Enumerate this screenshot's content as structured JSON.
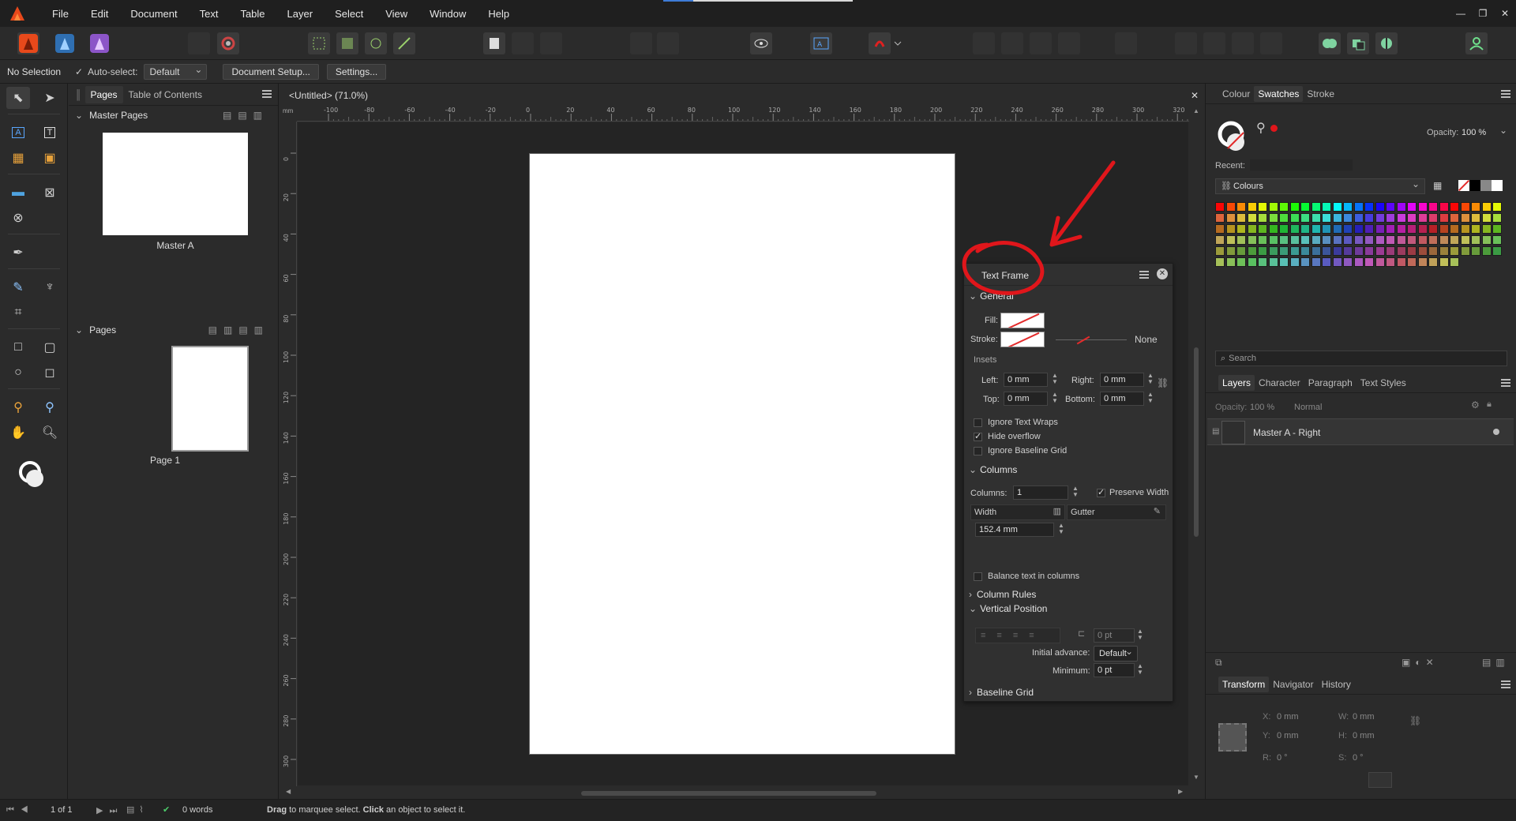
{
  "menubar": {
    "items": [
      "File",
      "Edit",
      "Document",
      "Text",
      "Table",
      "Layer",
      "Select",
      "View",
      "Window",
      "Help"
    ],
    "window_controls": [
      "—",
      "❐",
      "✕"
    ],
    "progress_percent": 16
  },
  "contextbar": {
    "selection_label": "No Selection",
    "autoselect_label": "Auto-select:",
    "autoselect_value": "Default",
    "document_setup_label": "Document Setup...",
    "settings_label": "Settings..."
  },
  "pages_panel": {
    "tabs": [
      "Pages",
      "Table of Contents"
    ],
    "master_pages_header": "Master Pages",
    "master_name": "Master A",
    "pages_header": "Pages",
    "page_name": "Page 1"
  },
  "document": {
    "tab_title": "<Untitled> (71.0%)",
    "close": "✕",
    "ruler_unit": "mm",
    "h_ticks": [
      "-100",
      "-80",
      "-60",
      "-40",
      "-20",
      "0",
      "20",
      "40",
      "60",
      "80",
      "100",
      "120",
      "140",
      "160",
      "180",
      "200",
      "220",
      "240",
      "260",
      "280",
      "300",
      "320"
    ],
    "v_ticks": [
      "0",
      "20",
      "40",
      "60",
      "80",
      "100",
      "120",
      "140",
      "160",
      "180",
      "200",
      "220",
      "240",
      "260",
      "280",
      "300"
    ]
  },
  "text_frame_panel": {
    "title": "Text Frame",
    "general_header": "General",
    "fill_label": "Fill:",
    "stroke_label": "Stroke:",
    "stroke_none": "None",
    "insets_label": "Insets",
    "left_label": "Left:",
    "left_value": "0 mm",
    "right_label": "Right:",
    "right_value": "0 mm",
    "top_label": "Top:",
    "top_value": "0 mm",
    "bottom_label": "Bottom:",
    "bottom_value": "0 mm",
    "ignore_text_wraps": "Ignore Text Wraps",
    "hide_overflow": "Hide overflow",
    "ignore_baseline_grid": "Ignore Baseline Grid",
    "columns_header": "Columns",
    "columns_label": "Columns:",
    "columns_value": "1",
    "preserve_width": "Preserve Width",
    "width_label": "Width",
    "gutter_label": "Gutter",
    "width_value": "152.4 mm",
    "balance_text": "Balance text in columns",
    "column_rules_header": "Column Rules",
    "vertical_position_header": "Vertical Position",
    "vp_value": "0 pt",
    "initial_advance_label": "Initial advance:",
    "initial_advance_value": "Default",
    "minimum_label": "Minimum:",
    "minimum_value": "0 pt",
    "baseline_grid_header": "Baseline Grid"
  },
  "right_panel": {
    "top_tabs": [
      "Colour",
      "Swatches",
      "Stroke"
    ],
    "opacity_label": "Opacity:",
    "opacity_value": "100 %",
    "recent_label": "Recent:",
    "palette_value": "Colours",
    "search_placeholder": "Search",
    "layer_tabs": [
      "Layers",
      "Character",
      "Paragraph",
      "Text Styles"
    ],
    "layer_opacity_label": "Opacity:",
    "layer_opacity_value": "100 %",
    "blend_mode": "Normal",
    "layer_name": "Master A - Right",
    "transform_tabs": [
      "Transform",
      "Navigator",
      "History"
    ],
    "x_label": "X:",
    "x_value": "0 mm",
    "y_label": "Y:",
    "y_value": "0 mm",
    "w_label": "W:",
    "w_value": "0 mm",
    "h_label": "H:",
    "h_value": "0 mm",
    "r_label": "R:",
    "r_value": "0 °",
    "s_label": "S:",
    "s_value": "0 °"
  },
  "statusbar": {
    "page_counter": "1 of 1",
    "words": "0 words",
    "hint_bold1": "Drag",
    "hint1": " to marquee select. ",
    "hint_bold2": "Click",
    "hint2": " an object to select it."
  },
  "colors": {
    "accent": "#3d7bd6",
    "annotation_red": "#e0161b",
    "app_orange": "#e8491b"
  }
}
